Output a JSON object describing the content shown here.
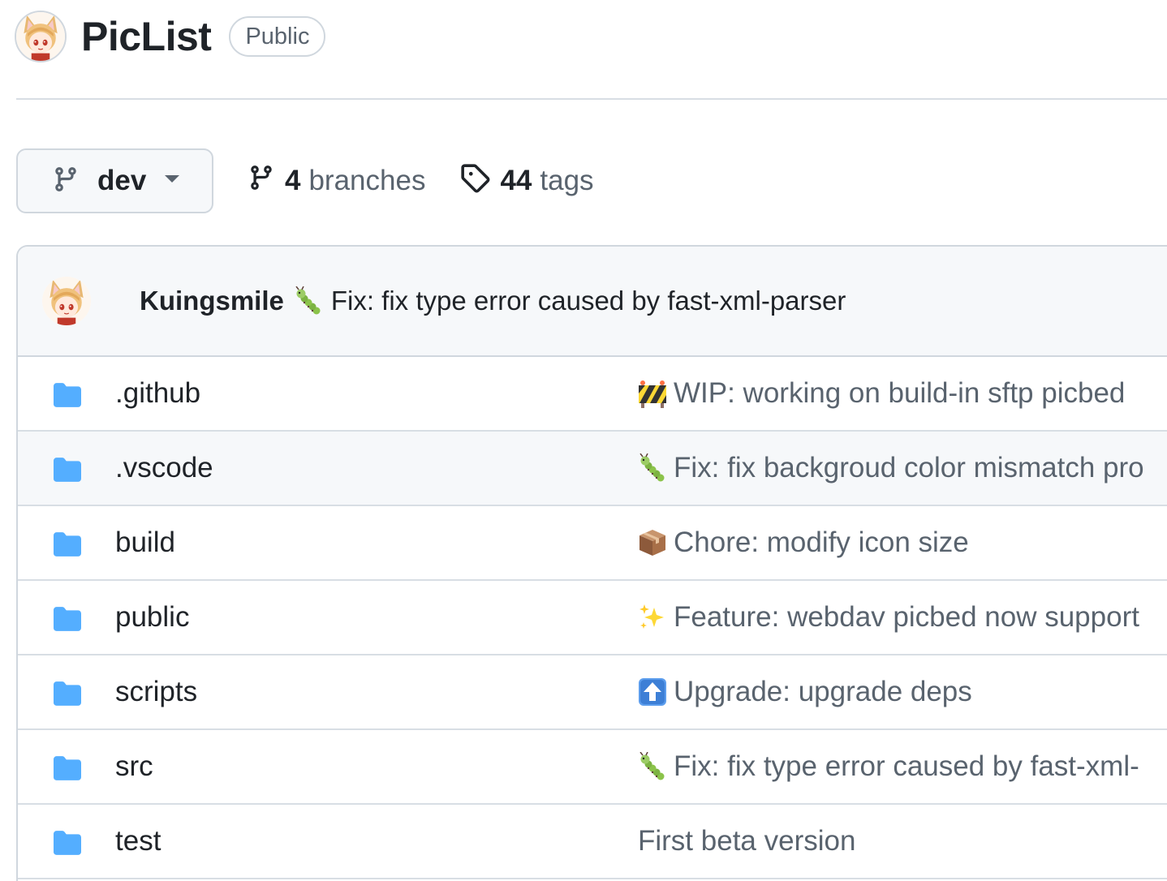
{
  "repo": {
    "name": "PicList",
    "visibility": "Public"
  },
  "branch": {
    "current": "dev",
    "branches_count": "4",
    "branches_label": "branches",
    "tags_count": "44",
    "tags_label": "tags"
  },
  "latest_commit": {
    "author": "Kuingsmile",
    "emoji": "bug-caterpillar-icon",
    "message": "Fix: fix type error caused by fast-xml-parser"
  },
  "files": [
    {
      "name": ".github",
      "emoji": "construction-icon",
      "message": "WIP: working on build-in sftp picbed"
    },
    {
      "name": ".vscode",
      "emoji": "bug-caterpillar-icon",
      "message": "Fix: fix backgroud color mismatch pro"
    },
    {
      "name": "build",
      "emoji": "package-icon",
      "message": "Chore: modify icon size"
    },
    {
      "name": "public",
      "emoji": "sparkles-icon",
      "message": "Feature: webdav picbed now support"
    },
    {
      "name": "scripts",
      "emoji": "up-arrow-icon",
      "message": "Upgrade: upgrade deps"
    },
    {
      "name": "src",
      "emoji": "bug-caterpillar-icon",
      "message": "Fix: fix type error caused by fast-xml-"
    },
    {
      "name": "test",
      "emoji": "",
      "message": "First beta version"
    }
  ],
  "colors": {
    "folder": "#54aeff",
    "border": "#d0d7de",
    "muted_text": "#59636e",
    "header_bg": "#f6f8fa"
  }
}
